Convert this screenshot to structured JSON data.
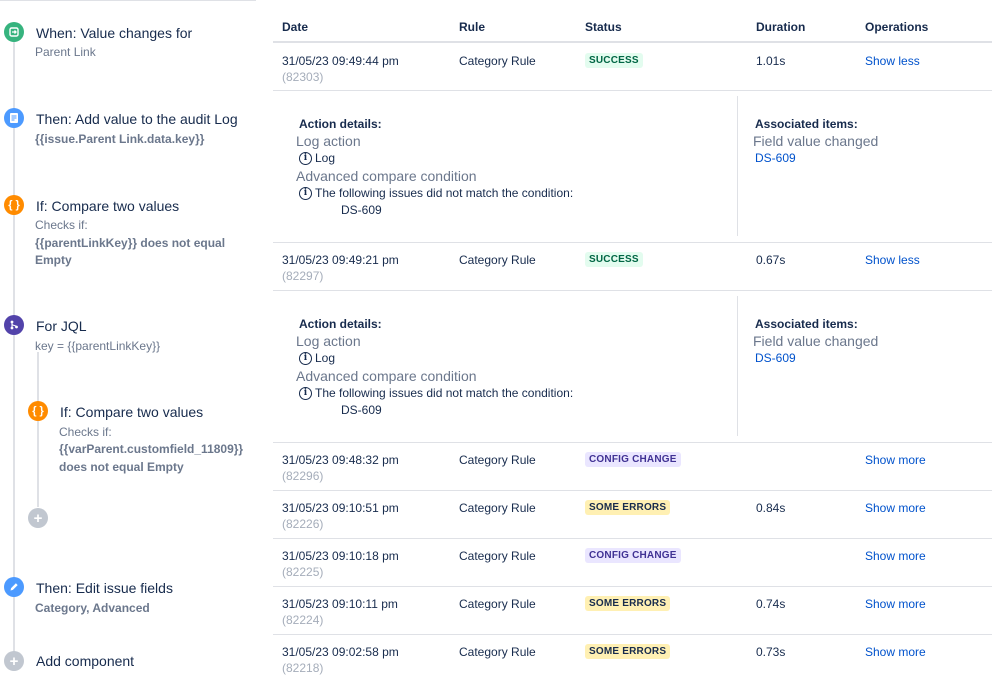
{
  "rule": {
    "trigger": {
      "title": "When: Value changes for",
      "field": "Parent Link"
    },
    "audit_action": {
      "title": "Then: Add value to the audit Log",
      "value": "{{issue.Parent Link.data.key}}"
    },
    "condition1": {
      "title": "If: Compare two values",
      "checks": "Checks if:",
      "expr": "{{parentLinkKey}} does not equal",
      "expr2": "Empty"
    },
    "branch": {
      "title": "For JQL",
      "jql": "key = {{parentLinkKey}}"
    },
    "condition2": {
      "title": "If: Compare two values",
      "checks": "Checks if:",
      "expr": "{{varParent.customfield_11809}}",
      "expr2": "does not equal Empty"
    },
    "edit": {
      "title": "Then: Edit issue fields",
      "fields": "Category, Advanced"
    },
    "add_component": "Add component"
  },
  "audit": {
    "headers": {
      "date": "Date",
      "rule": "Rule",
      "status": "Status",
      "duration": "Duration",
      "operations": "Operations"
    },
    "rows": [
      {
        "date": "31/05/23 09:49:44 pm",
        "id": "(82303)",
        "rule": "Category Rule",
        "status": "SUCCESS",
        "duration": "1.01s",
        "op": "Show less"
      },
      {
        "date": "31/05/23 09:49:21 pm",
        "id": "(82297)",
        "rule": "Category Rule",
        "status": "SUCCESS",
        "duration": "0.67s",
        "op": "Show less"
      },
      {
        "date": "31/05/23 09:48:32 pm",
        "id": "(82296)",
        "rule": "Category Rule",
        "status": "CONFIG CHANGE",
        "duration": "",
        "op": "Show more"
      },
      {
        "date": "31/05/23 09:10:51 pm",
        "id": "(82226)",
        "rule": "Category Rule",
        "status": "SOME ERRORS",
        "duration": "0.84s",
        "op": "Show more"
      },
      {
        "date": "31/05/23 09:10:18 pm",
        "id": "(82225)",
        "rule": "Category Rule",
        "status": "CONFIG CHANGE",
        "duration": "",
        "op": "Show more"
      },
      {
        "date": "31/05/23 09:10:11 pm",
        "id": "(82224)",
        "rule": "Category Rule",
        "status": "SOME ERRORS",
        "duration": "0.74s",
        "op": "Show more"
      },
      {
        "date": "31/05/23 09:02:58 pm",
        "id": "(82218)",
        "rule": "Category Rule",
        "status": "SOME ERRORS",
        "duration": "0.73s",
        "op": "Show more"
      }
    ],
    "details": [
      {
        "action_heading": "Action details:",
        "log_action": "Log action",
        "log": "Log",
        "compare": "Advanced compare condition",
        "compare_msg": "The following issues did not match the condition:",
        "issue": "DS-609",
        "assoc_heading": "Associated items:",
        "assoc_type": "Field value changed",
        "assoc_issue": "DS-609"
      },
      {
        "action_heading": "Action details:",
        "log_action": "Log action",
        "log": "Log",
        "compare": "Advanced compare condition",
        "compare_msg": "The following issues did not match the condition:",
        "issue": "DS-609",
        "assoc_heading": "Associated items:",
        "assoc_type": "Field value changed",
        "assoc_issue": "DS-609"
      }
    ]
  },
  "colors": {
    "trigger": "#36b37e",
    "action": "#4c9aff",
    "condition": "#ff8b00",
    "branch": "#5243aa",
    "add": "#c1c7d0",
    "link": "#0052cc"
  },
  "icons": {
    "trigger": "trigger-icon",
    "action": "document-icon",
    "condition": "braces-icon",
    "branch": "branch-icon",
    "edit": "pencil-icon",
    "add": "plus-icon"
  }
}
